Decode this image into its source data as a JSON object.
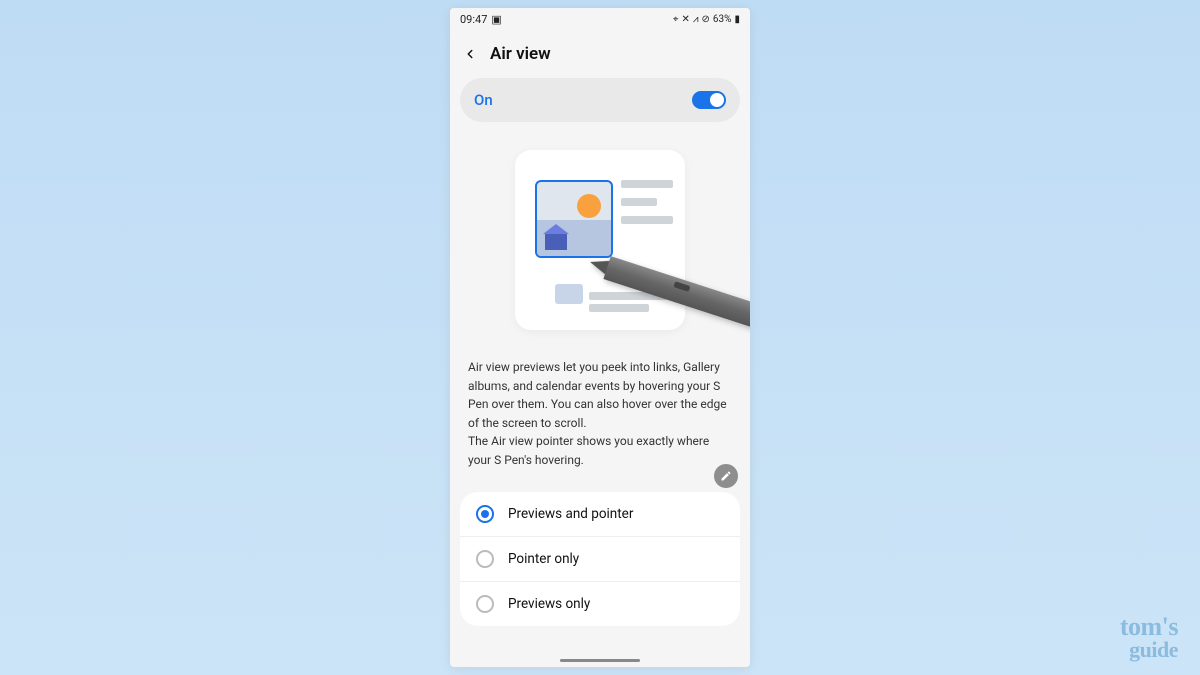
{
  "status": {
    "time": "09:47",
    "battery": "63%"
  },
  "header": {
    "title": "Air view"
  },
  "toggle": {
    "label": "On",
    "state": true
  },
  "description": {
    "para1": "Air view previews let you peek into links, Gallery albums, and calendar events by hovering your S Pen over them. You can also hover over the edge of the screen to scroll.",
    "para2": "The Air view pointer shows you exactly where your S Pen's hovering."
  },
  "options": [
    {
      "label": "Previews and pointer",
      "selected": true
    },
    {
      "label": "Pointer only",
      "selected": false
    },
    {
      "label": "Previews only",
      "selected": false
    }
  ],
  "watermark": {
    "line1": "tom's",
    "line2": "guide"
  }
}
